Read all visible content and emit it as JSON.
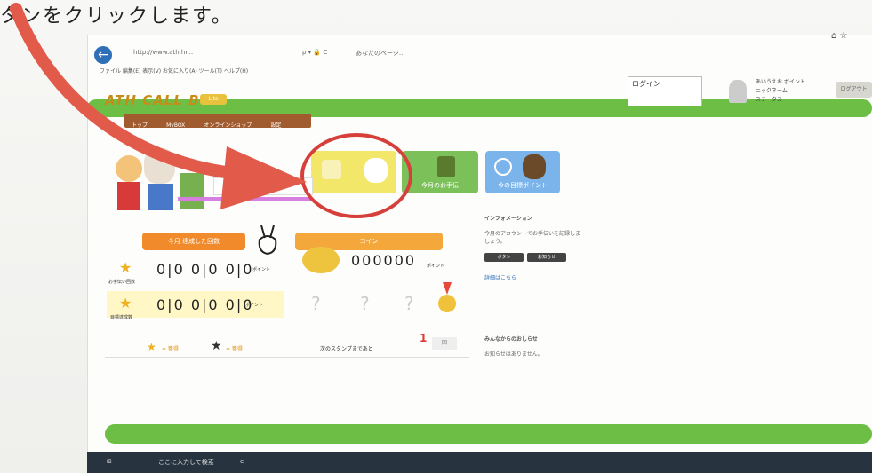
{
  "heading": "タンをクリックします。",
  "browser": {
    "address": "http://www.ath.hr...",
    "search_hint": "ρ ▾ 🔒 C",
    "tab_title": "あなたのページ..."
  },
  "favorites": "ファイル  編集(E)  表示(V)  お気に入り(A)  ツール(T)  ヘルプ(H)",
  "site": {
    "logo": "ATH CALL BOX",
    "logo_badge": "Lite",
    "nav": [
      "トップ",
      "MyBOX",
      "オンラインショップ",
      "設定"
    ],
    "user_box": "ログイン",
    "user_info": [
      "あいうえお ポイント",
      "ニックネーム",
      "ステータス"
    ],
    "top_button": "ログアウト"
  },
  "cards": [
    {
      "label": ""
    },
    {
      "label": "今月のお手伝"
    },
    {
      "label": "今の目標ポイント"
    }
  ],
  "stamps": {
    "banner_left": "今月 達成した回数",
    "banner_right": "コイン",
    "counter1": "0|0 0|0 0|0",
    "counter2": "0|0 0|0 0|0",
    "coin_counter": "000000",
    "label_small": "ポイント",
    "row_labels": [
      "お手伝い回数",
      "目標達成数"
    ],
    "stars_text": "= 獲得",
    "next_stamp": "次のスタンプまであと",
    "next_count": "1",
    "next_suffix": "回"
  },
  "right_panel": {
    "title": "インフォメーション",
    "text1": "今月のアカウントでお手伝いを記録しましょう。",
    "btn1": "ボタン",
    "btn2": "お知らせ",
    "link": "詳細はこちら",
    "title2": "みんなからのおしらせ",
    "text2": "お知らせはありません。"
  },
  "taskbar": {
    "item1": "ここに入力して検索",
    "item2": "e"
  }
}
